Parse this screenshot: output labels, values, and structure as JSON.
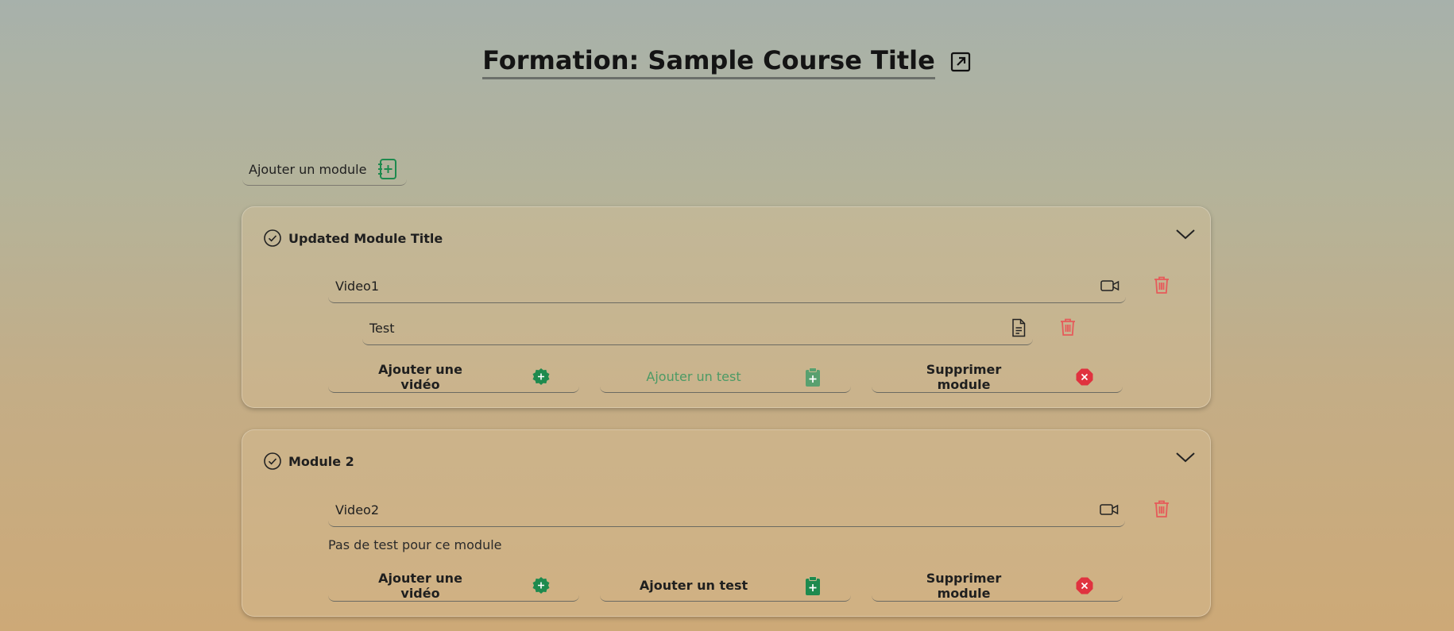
{
  "page": {
    "title": "Formation: Sample Course Title",
    "open_icon": "external-link-icon"
  },
  "toolbar": {
    "add_module_label": "Ajouter un module",
    "add_module_icon": "add-notebook-icon"
  },
  "colors": {
    "accent_green": "#1e8a4e",
    "danger_red": "#e0323f",
    "trash_red": "#e65a5a"
  },
  "modules": [
    {
      "title": "Updated Module Title",
      "status_icon": "check-circle-icon",
      "videos": [
        {
          "title": "Video1",
          "icon": "video-camera-icon"
        }
      ],
      "test": {
        "title": "Test",
        "icon": "document-icon"
      },
      "no_test_text": "",
      "actions": {
        "add_video": "Ajouter une vidéo",
        "add_test": "Ajouter un test",
        "add_test_disabled": true,
        "delete_module": "Supprimer module"
      }
    },
    {
      "title": "Module 2",
      "status_icon": "check-circle-icon",
      "videos": [
        {
          "title": "Video2",
          "icon": "video-camera-icon"
        }
      ],
      "test": null,
      "no_test_text": "Pas de test pour ce module",
      "actions": {
        "add_video": "Ajouter une vidéo",
        "add_test": "Ajouter un test",
        "add_test_disabled": false,
        "delete_module": "Supprimer module"
      }
    }
  ]
}
